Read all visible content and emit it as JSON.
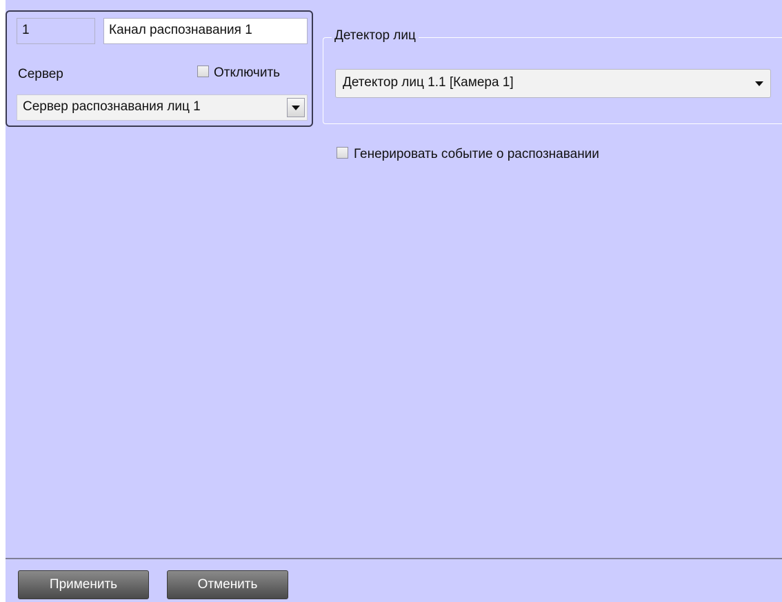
{
  "object": {
    "id": "1",
    "name": "Канал распознавания 1",
    "server_label": "Сервер",
    "disable_label": "Отключить",
    "disable_checked": false,
    "server_value": "Сервер распознавания лиц 1"
  },
  "detector_group": {
    "legend": "Детектор лиц",
    "selected": "Детектор лиц 1.1 [Камера 1]"
  },
  "generate_event": {
    "label": "Генерировать событие о распознавании",
    "checked": false
  },
  "footer": {
    "apply_label": "Применить",
    "cancel_label": "Отменить"
  },
  "icons": {
    "dropdown": "chevron-down-icon",
    "checkbox": "checkbox-icon"
  },
  "colors": {
    "panel_background": "#ccccff",
    "button_background": "#5a5a5a",
    "border_dark": "#3a3a52"
  }
}
